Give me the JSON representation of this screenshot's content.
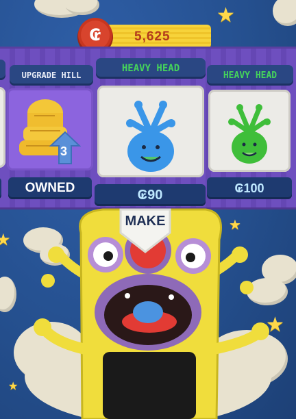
{
  "header": {
    "coins": "5,625",
    "coin_symbol": "₢"
  },
  "shop": {
    "tabs": [
      {
        "label": "UPGRADE HILL"
      },
      {
        "label": "HEAVY HEAD"
      },
      {
        "label": "HEAVY HEAD"
      }
    ],
    "items": [
      {
        "name": "upgrade-hill",
        "status": "OWNED",
        "level": "3"
      },
      {
        "name": "heavy-head-blue",
        "price": "₢90",
        "color": "#3a96e8"
      },
      {
        "name": "heavy-head-green",
        "price": "₢100",
        "color": "#3fbe3a"
      }
    ]
  },
  "action": {
    "make_label": "MAKE"
  },
  "colors": {
    "sky": "#25508f",
    "rail": "#6e4fbf",
    "coin_bar": "#f7d33a",
    "coin_text": "#b33a1c",
    "monster": "#f0dd3c"
  }
}
